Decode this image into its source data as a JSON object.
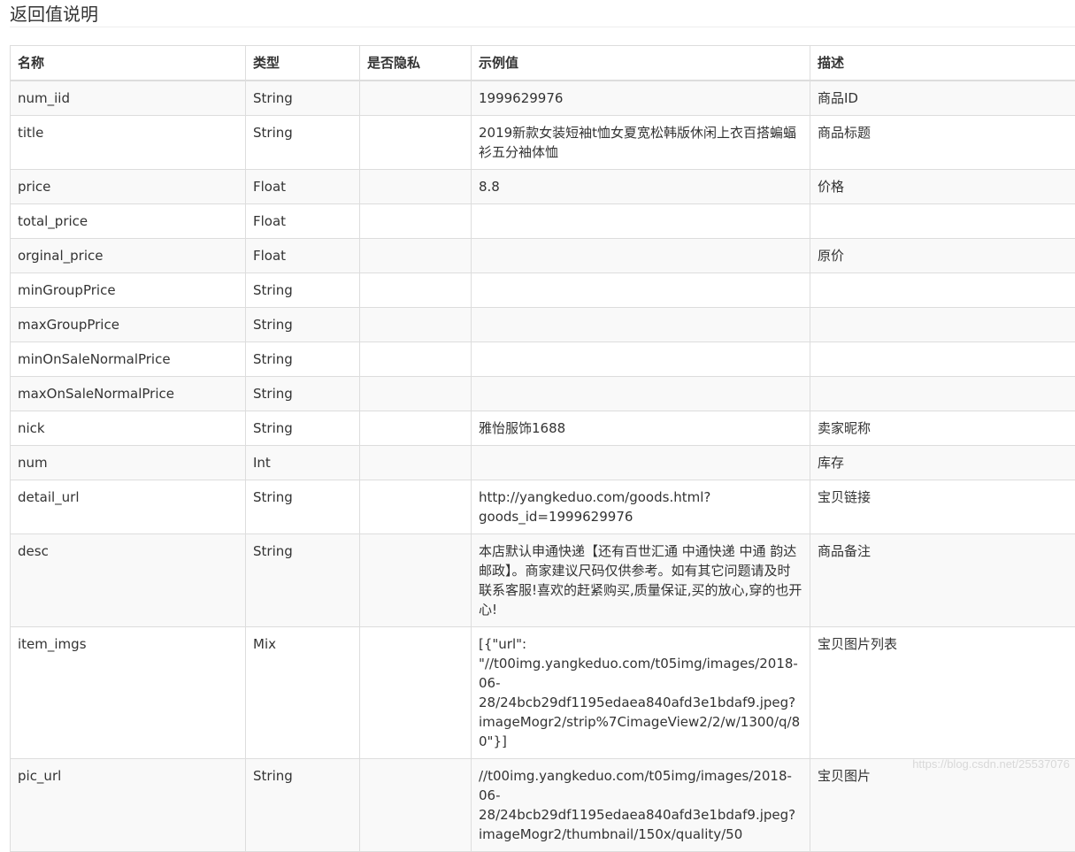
{
  "section": {
    "title": "返回值说明"
  },
  "table": {
    "headers": [
      "名称",
      "类型",
      "是否隐私",
      "示例值",
      "描述"
    ],
    "rows": [
      {
        "name": "num_iid",
        "type": "String",
        "private": "",
        "example": "1999629976",
        "desc": "商品ID"
      },
      {
        "name": "title",
        "type": "String",
        "private": "",
        "example": "2019新款女装短袖t恤女夏宽松韩版休闲上衣百搭蝙蝠衫五分袖体恤",
        "desc": "商品标题"
      },
      {
        "name": "price",
        "type": "Float",
        "private": "",
        "example": "8.8",
        "desc": "价格"
      },
      {
        "name": "total_price",
        "type": "Float",
        "private": "",
        "example": "",
        "desc": ""
      },
      {
        "name": "orginal_price",
        "type": "Float",
        "private": "",
        "example": "",
        "desc": "原价"
      },
      {
        "name": "minGroupPrice",
        "type": "String",
        "private": "",
        "example": "",
        "desc": ""
      },
      {
        "name": "maxGroupPrice",
        "type": "String",
        "private": "",
        "example": "",
        "desc": ""
      },
      {
        "name": "minOnSaleNormalPrice",
        "type": "String",
        "private": "",
        "example": "",
        "desc": ""
      },
      {
        "name": "maxOnSaleNormalPrice",
        "type": "String",
        "private": "",
        "example": "",
        "desc": ""
      },
      {
        "name": "nick",
        "type": "String",
        "private": "",
        "example": "雅怡服饰1688",
        "desc": "卖家昵称"
      },
      {
        "name": "num",
        "type": "Int",
        "private": "",
        "example": "",
        "desc": "库存"
      },
      {
        "name": "detail_url",
        "type": "String",
        "private": "",
        "example": "http://yangkeduo.com/goods.html?goods_id=1999629976",
        "desc": "宝贝链接"
      },
      {
        "name": "desc",
        "type": "String",
        "private": "",
        "example": "本店默认申通快递【还有百世汇通 中通快递 中通 韵达 邮政】。商家建议尺码仅供参考。如有其它问题请及时联系客服!喜欢的赶紧购买,质量保证,买的放心,穿的也开心!",
        "desc": "商品备注"
      },
      {
        "name": "item_imgs",
        "type": "Mix",
        "private": "",
        "example": "[{\"url\": \"//t00img.yangkeduo.com/t05img/images/2018-06-28/24bcb29df1195edaea840afd3e1bdaf9.jpeg?imageMogr2/strip%7CimageView2/2/w/1300/q/80\"}]",
        "desc": "宝贝图片列表"
      },
      {
        "name": "pic_url",
        "type": "String",
        "private": "",
        "example": "//t00img.yangkeduo.com/t05img/images/2018-06-28/24bcb29df1195edaea840afd3e1bdaf9.jpeg?imageMogr2/thumbnail/150x/quality/50",
        "desc": "宝贝图片"
      }
    ]
  },
  "watermark": "https://blog.csdn.net/25537076"
}
